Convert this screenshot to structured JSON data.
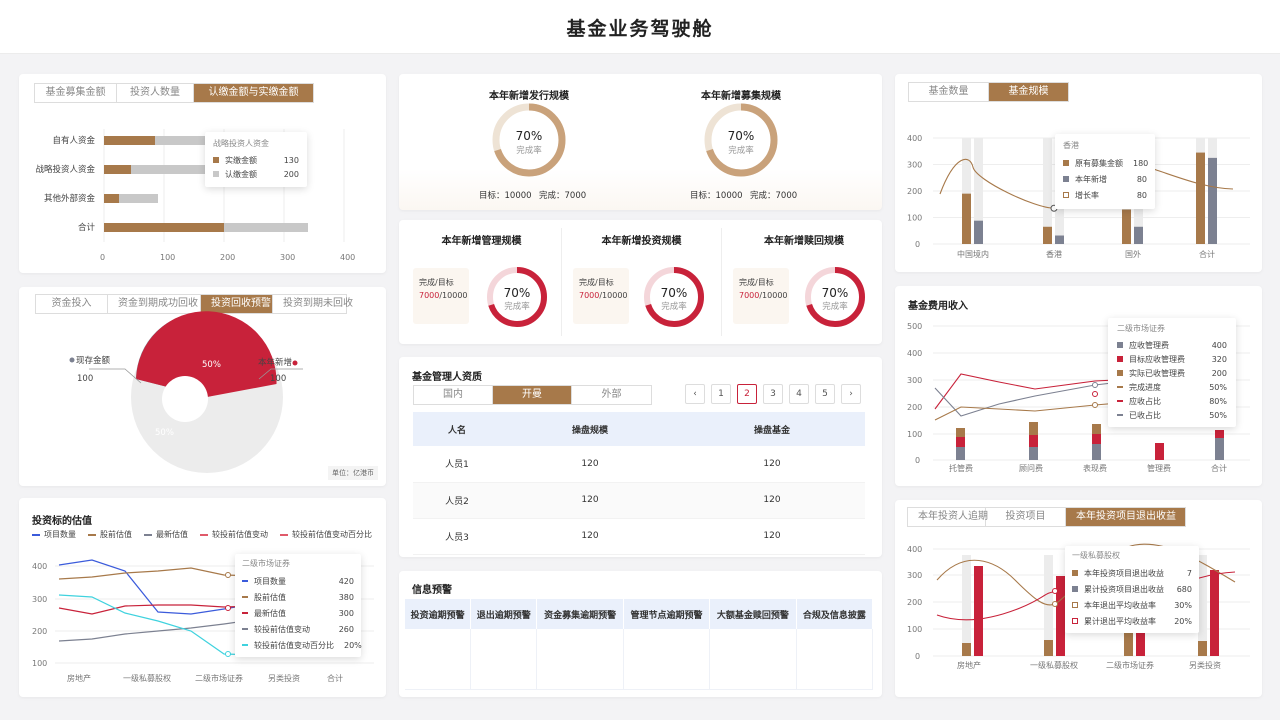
{
  "header": {
    "title": "基金业务驾驶舱"
  },
  "p1": {
    "tabs": [
      "基金募集金额",
      "投资人数量",
      "认缴金额与实缴金额"
    ],
    "categories": [
      "自有人资金",
      "战略投资人资金",
      "其他外部资金",
      "合计"
    ],
    "paid": [
      85,
      45,
      25,
      200
    ],
    "subscribed": [
      200,
      200,
      90,
      340
    ],
    "xticks": [
      "0",
      "100",
      "200",
      "300",
      "400"
    ],
    "tooltip": {
      "title": "战略投资人资金",
      "rows": [
        {
          "name": "实缴金额",
          "value": "130"
        },
        {
          "name": "认缴金额",
          "value": "200"
        }
      ]
    }
  },
  "p2": {
    "tabs": [
      "资金投入",
      "资金到期成功回收",
      "投资回收预警",
      "投资到期未回收"
    ],
    "left_label": "现存金额",
    "left_value": "100",
    "right_label": "本年新增",
    "right_value": "100",
    "slice_red": "50%",
    "slice_gray": "50%",
    "unit": "单位：亿港币"
  },
  "p3": {
    "title": "投资标的估值",
    "legend": [
      "项目数量",
      "股前估值",
      "最新估值",
      "较投前估值变动",
      "较投前估值变动百分比"
    ],
    "categories": [
      "房地产",
      "一级私募股权",
      "二级市场证券",
      "另类投资",
      "合计"
    ],
    "yticks": [
      "400",
      "300",
      "200",
      "100"
    ],
    "tooltip": {
      "title": "二级市场证券",
      "rows": [
        {
          "name": "项目数量",
          "value": "420"
        },
        {
          "name": "股前估值",
          "value": "380"
        },
        {
          "name": "最新估值",
          "value": "300"
        },
        {
          "name": "较投前估值变动",
          "value": "260"
        },
        {
          "name": "较投前估值变动百分比",
          "value": "20%"
        }
      ]
    }
  },
  "k1": {
    "items": [
      {
        "title": "本年新增发行规模",
        "pct": "70%",
        "label": "完成率",
        "target": "目标：10000",
        "done": "完成：7000"
      },
      {
        "title": "本年新增募集规模",
        "pct": "70%",
        "label": "完成率",
        "target": "目标：10000",
        "done": "完成：7000"
      }
    ]
  },
  "k2": {
    "items": [
      {
        "title": "本年新增管理规模",
        "ratio_label": "完成/目标",
        "done": "7000",
        "target": "/10000",
        "pct": "70%",
        "label": "完成率"
      },
      {
        "title": "本年新增投资规模",
        "ratio_label": "完成/目标",
        "done": "7000",
        "target": "/10000",
        "pct": "70%",
        "label": "完成率"
      },
      {
        "title": "本年新增赎回规模",
        "ratio_label": "完成/目标",
        "done": "7000",
        "target": "/10000",
        "pct": "70%",
        "label": "完成率"
      }
    ]
  },
  "mgr": {
    "title": "基金管理人资质",
    "tabs": [
      "国内",
      "开曼",
      "外部"
    ],
    "pages": [
      "1",
      "2",
      "3",
      "4",
      "5"
    ],
    "headers": [
      "人名",
      "操盘规模",
      "操盘基金"
    ],
    "rows": [
      [
        "人员1",
        "120",
        "120"
      ],
      [
        "人员2",
        "120",
        "120"
      ],
      [
        "人员3",
        "120",
        "120"
      ]
    ]
  },
  "warn": {
    "title": "信息预警",
    "headers": [
      "投资逾期预警",
      "退出逾期预警",
      "资金募集逾期预警",
      "管理节点逾期预警",
      "大额基金赎回预警",
      "合规及信息披露"
    ]
  },
  "r1": {
    "tabs": [
      "基金数量",
      "基金规模"
    ],
    "categories": [
      "中国境内",
      "香港",
      "国外",
      "合计"
    ],
    "original": [
      190,
      65,
      130,
      345
    ],
    "added": [
      88,
      32,
      65,
      325
    ],
    "growth": [
      290,
      135,
      300,
      210
    ],
    "yticks": [
      "400",
      "300",
      "200",
      "100",
      "0"
    ],
    "tooltip": {
      "title": "香港",
      "rows": [
        {
          "name": "原有募集金额",
          "value": "180"
        },
        {
          "name": "本年新增",
          "value": "80"
        },
        {
          "name": "增长率",
          "value": "80"
        }
      ]
    }
  },
  "r2": {
    "title": "基金费用收入",
    "categories": [
      "托管费",
      "顾问费",
      "表现费",
      "管理费",
      "合计"
    ],
    "yticks": [
      "500",
      "400",
      "300",
      "200",
      "100",
      "0"
    ],
    "tooltip": {
      "title": "二级市场证券",
      "rows": [
        {
          "name": "应收管理费",
          "value": "400"
        },
        {
          "name": "目标应收管理费",
          "value": "320"
        },
        {
          "name": "实际已收管理费",
          "value": "200"
        },
        {
          "name": "完成进度",
          "value": "50%"
        },
        {
          "name": "应收占比",
          "value": "80%"
        },
        {
          "name": "已收占比",
          "value": "50%"
        }
      ]
    }
  },
  "r3": {
    "tabs": [
      "本年投资人追期",
      "投资项目",
      "本年投资项目退出收益"
    ],
    "categories": [
      "房地产",
      "一级私募股权",
      "二级市场证券",
      "另类投资"
    ],
    "yticks": [
      "400",
      "300",
      "200",
      "100",
      "0"
    ],
    "tooltip": {
      "title": "一级私募股权",
      "rows": [
        {
          "name": "本年投资项目退出收益",
          "value": "7"
        },
        {
          "name": "累计投资项目退出收益",
          "value": "680"
        },
        {
          "name": "本年退出平均收益率",
          "value": "30%"
        },
        {
          "name": "累计退出平均收益率",
          "value": "20%"
        }
      ]
    }
  },
  "colors": {
    "brown": "#a7794a",
    "gray": "#c8c8c8",
    "red": "#c8223a",
    "slate": "#7c8191",
    "cyan": "#3fd2de"
  }
}
